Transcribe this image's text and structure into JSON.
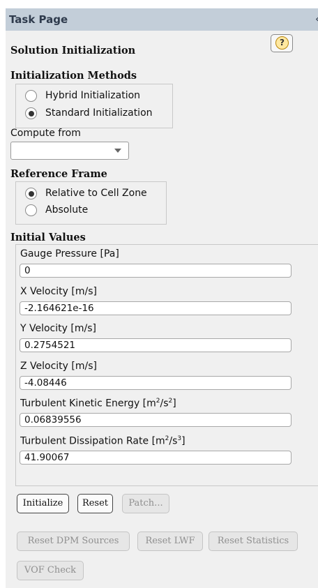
{
  "header": {
    "title": "Task Page",
    "collapse_glyph": "‹"
  },
  "page_title": "Solution Initialization",
  "help_icon": "help-icon",
  "init_methods": {
    "label": "Initialization Methods",
    "options": [
      {
        "label": "Hybrid  Initialization",
        "selected": false
      },
      {
        "label": "Standard Initialization",
        "selected": true
      }
    ]
  },
  "compute_from": {
    "label": "Compute from",
    "value": ""
  },
  "reference_frame": {
    "label": "Reference Frame",
    "options": [
      {
        "label": "Relative to Cell Zone",
        "selected": true
      },
      {
        "label": "Absolute",
        "selected": false
      }
    ]
  },
  "initial_values": {
    "label": "Initial Values",
    "fields": [
      {
        "label": "Gauge Pressure [Pa]",
        "value": "0"
      },
      {
        "label": "X Velocity [m/s]",
        "value": "-2.164621e-16"
      },
      {
        "label": "Y Velocity [m/s]",
        "value": "0.2754521"
      },
      {
        "label": "Z Velocity [m/s]",
        "value": "-4.08446"
      },
      {
        "label_main": "Turbulent Kinetic Energy [m",
        "label_tail": "/s",
        "label_end": "]",
        "sup1": "2",
        "sup2": "2",
        "value": "0.06839556"
      },
      {
        "label_main": "Turbulent Dissipation Rate [m",
        "label_tail": "/s",
        "label_end": "]",
        "sup1": "2",
        "sup2": "3",
        "value": "41.90067"
      }
    ]
  },
  "buttons": {
    "initialize": "Initialize",
    "reset": "Reset",
    "patch": "Patch...",
    "reset_dpm": "Reset DPM Sources",
    "reset_lwf": "Reset LWF",
    "reset_statistics": "Reset Statistics",
    "vof_check": "VOF Check"
  },
  "colors": {
    "header_bg": "#c3ced9",
    "panel_bg": "#f0f0f0",
    "disabled_text": "#8f8f8f"
  }
}
